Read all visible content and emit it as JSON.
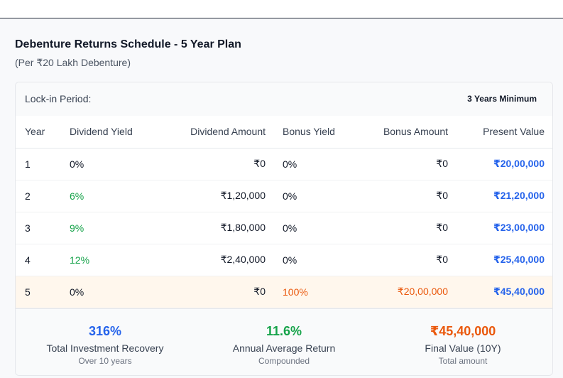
{
  "header": {
    "title": "Debenture Returns Schedule - 5 Year Plan",
    "subtitle": "(Per ₹20 Lakh Debenture)"
  },
  "lock_in": {
    "label": "Lock-in Period:",
    "value": "3 Years Minimum"
  },
  "table": {
    "columns": [
      "Year",
      "Dividend Yield",
      "Dividend Amount",
      "Bonus Yield",
      "Bonus Amount",
      "Present Value"
    ],
    "rows": [
      {
        "year": "1",
        "dividend_yield": "0%",
        "dividend_amount": "₹0",
        "bonus_yield": "0%",
        "bonus_amount": "₹0",
        "present_value": "₹20,00,000"
      },
      {
        "year": "2",
        "dividend_yield": "6%",
        "dividend_amount": "₹1,20,000",
        "bonus_yield": "0%",
        "bonus_amount": "₹0",
        "present_value": "₹21,20,000"
      },
      {
        "year": "3",
        "dividend_yield": "9%",
        "dividend_amount": "₹1,80,000",
        "bonus_yield": "0%",
        "bonus_amount": "₹0",
        "present_value": "₹23,00,000"
      },
      {
        "year": "4",
        "dividend_yield": "12%",
        "dividend_amount": "₹2,40,000",
        "bonus_yield": "0%",
        "bonus_amount": "₹0",
        "present_value": "₹25,40,000"
      },
      {
        "year": "5",
        "dividend_yield": "0%",
        "dividend_amount": "₹0",
        "bonus_yield": "100%",
        "bonus_amount": "₹20,00,000",
        "present_value": "₹45,40,000"
      }
    ]
  },
  "summary": [
    {
      "value": "316%",
      "label": "Total Investment Recovery",
      "sub": "Over 10 years",
      "color": "#2563eb"
    },
    {
      "value": "11.6%",
      "label": "Annual Average Return",
      "sub": "Compounded",
      "color": "#16a34a"
    },
    {
      "value": "₹45,40,000",
      "label": "Final Value (10Y)",
      "sub": "Total amount",
      "color": "#ea580c"
    }
  ],
  "colors": {
    "positive": "#16a34a",
    "bonus": "#ea580c",
    "value": "#2563eb",
    "highlight_row": "#fff7ed"
  }
}
